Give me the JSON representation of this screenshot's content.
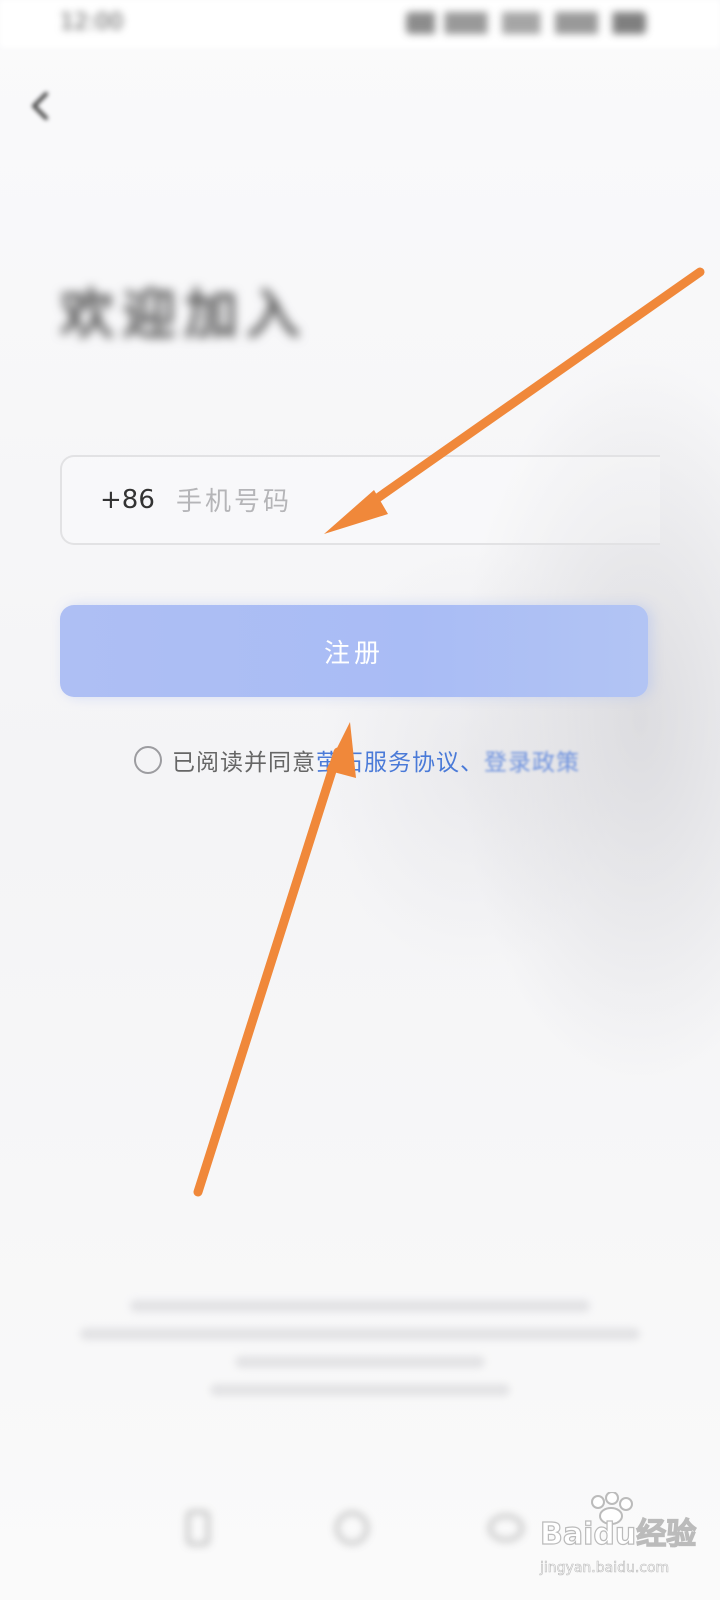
{
  "status_bar": {
    "time": "12:00"
  },
  "icons": {
    "back": "back-arrow-icon",
    "radio": "radio-unchecked-icon",
    "bottom_left": "phone-icon",
    "bottom_center": "qq-icon",
    "bottom_right": "wechat-icon",
    "watermark": "baidu-paw-logo"
  },
  "header": {
    "title": "欢迎加入"
  },
  "phone_field": {
    "country_code": "+86",
    "placeholder": "手机号码",
    "value": ""
  },
  "register_button": {
    "label": "注册"
  },
  "agreement": {
    "prefix": "已阅读并同意",
    "service_link_part1": "萤",
    "service_link_part2": "石服务协议",
    "separator": "、",
    "policy_link": "登录政策",
    "checked": false
  },
  "watermark": {
    "brand": "Baidu经验",
    "url": "jingyan.baidu.com"
  },
  "colors": {
    "accent": "#4a7ad8",
    "button": "#a9bcf5",
    "arrow": "#f0883a"
  }
}
